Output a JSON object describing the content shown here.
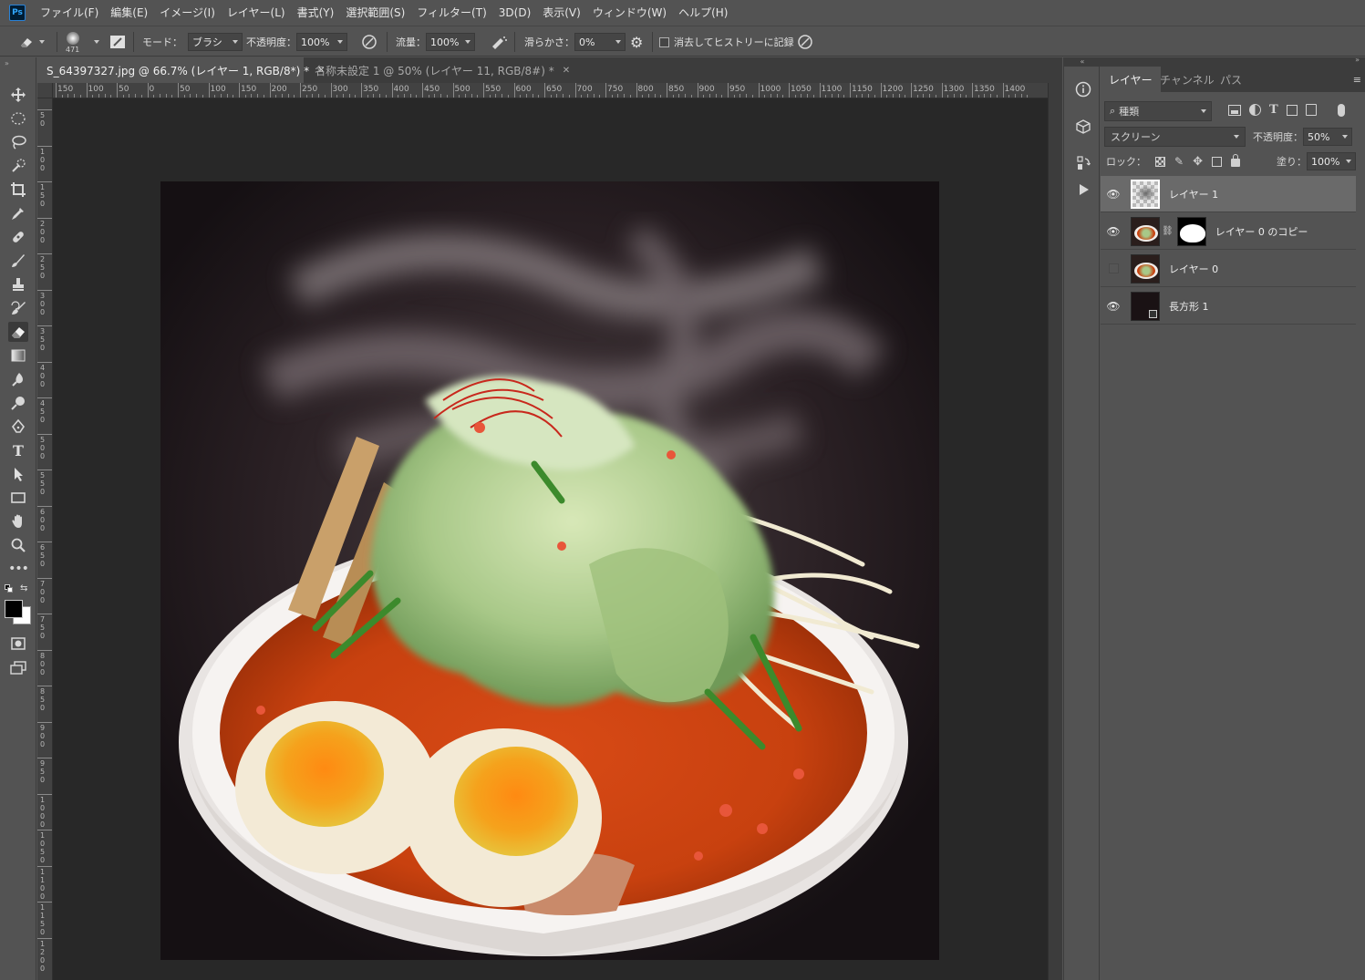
{
  "menubar": {
    "logo": "Ps",
    "items": [
      "ファイル(F)",
      "編集(E)",
      "イメージ(I)",
      "レイヤー(L)",
      "書式(Y)",
      "選択範囲(S)",
      "フィルター(T)",
      "3D(D)",
      "表示(V)",
      "ウィンドウ(W)",
      "ヘルプ(H)"
    ]
  },
  "options": {
    "brush_size": "471",
    "mode_label": "モード：",
    "mode_value": "ブラシ",
    "opacity_label": "不透明度：",
    "opacity_value": "100%",
    "flow_label": "流量：",
    "flow_value": "100%",
    "smoothing_label": "滑らかさ：",
    "smoothing_value": "0%",
    "erase_history_label": "消去してヒストリーに記録",
    "erase_history_checked": false
  },
  "tabs": [
    {
      "label": "S_64397327.jpg @ 66.7% (レイヤー 1, RGB/8*) *",
      "active": true
    },
    {
      "label": "名称未設定 1 @ 50% (レイヤー 11, RGB/8#) *",
      "active": false
    }
  ],
  "ruler": {
    "h_labels": [
      "150",
      "100",
      "50",
      "0",
      "50",
      "100",
      "150",
      "200",
      "250",
      "300",
      "350",
      "400",
      "450",
      "500",
      "550",
      "600",
      "650",
      "700",
      "750",
      "800",
      "850",
      "900",
      "950",
      "1000",
      "1050",
      "1100",
      "1150",
      "1200",
      "1250",
      "1300",
      "1350",
      "1400"
    ],
    "v_labels": [
      "50",
      "100",
      "150",
      "200",
      "250",
      "300",
      "350",
      "400",
      "450",
      "500",
      "550",
      "600",
      "650",
      "700",
      "750",
      "800",
      "850",
      "900",
      "950",
      "1000",
      "1050",
      "1100",
      "1150",
      "1200"
    ]
  },
  "panel": {
    "tabs": [
      "レイヤー",
      "チャンネル",
      "パス"
    ],
    "active_tab": "レイヤー",
    "filter_kind": "種類",
    "blend_mode": "スクリーン",
    "opacity_label": "不透明度：",
    "opacity_value": "50%",
    "lock_label": "ロック：",
    "fill_label": "塗り：",
    "fill_value": "100%",
    "layers": [
      {
        "name": "レイヤー 1",
        "visible": true,
        "selected": true,
        "thumb": "smoke"
      },
      {
        "name": "レイヤー 0 のコピー",
        "visible": true,
        "selected": false,
        "thumb": "ramen",
        "mask": true
      },
      {
        "name": "レイヤー 0",
        "visible": false,
        "selected": false,
        "thumb": "ramen"
      },
      {
        "name": "長方形 1",
        "visible": true,
        "selected": false,
        "thumb": "dark-shape"
      }
    ]
  },
  "colors": {
    "foreground": "#000000",
    "background": "#ffffff",
    "accent": "#31a8ff"
  }
}
